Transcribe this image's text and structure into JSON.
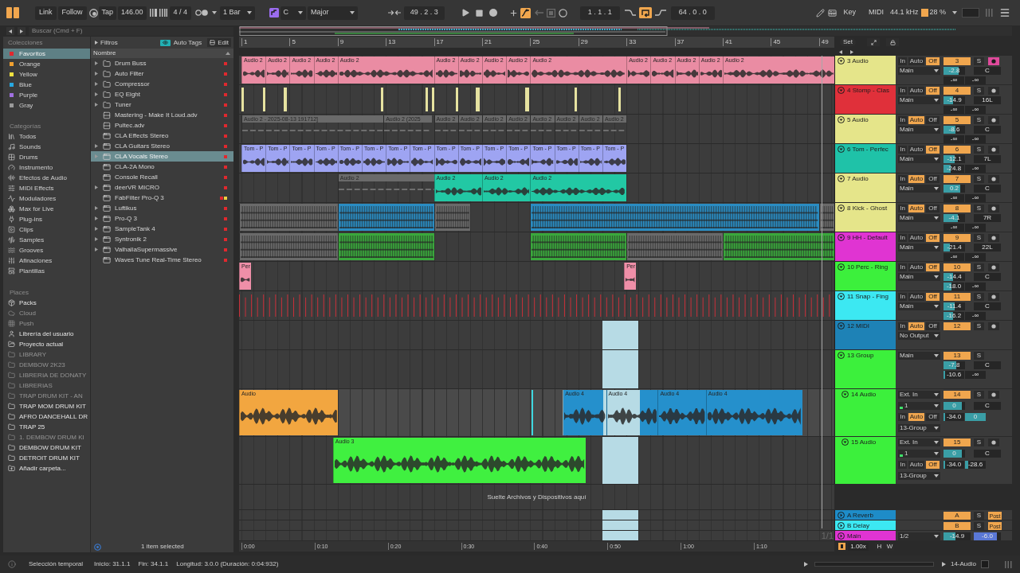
{
  "toolbar": {
    "link": "Link",
    "follow": "Follow",
    "tap": "Tap",
    "tempo": "146.00",
    "signature": "4 / 4",
    "quantization": "1 Bar",
    "key": {
      "on": true,
      "root": "C",
      "scale": "Major"
    },
    "position": "49 . 2 . 3",
    "automation_arm": true,
    "loop_start": "1 . 1 . 1",
    "loop": true,
    "loop_length": "64 . 0 . 0",
    "key_map": "Key",
    "midi_map": "MIDI",
    "sample_rate": "44.1 kHz",
    "cpu": "28 %"
  },
  "search": {
    "placeholder": "Buscar (Cmd + F)"
  },
  "browser": {
    "collections_title": "Colecciones",
    "filters": "Filtros",
    "auto_tags": {
      "label": "Auto Tags",
      "on": true
    },
    "edit": "Edit",
    "collections": [
      {
        "label": "Favoritos",
        "color": "#e0282e",
        "selected": true
      },
      {
        "label": "Orange",
        "color": "#f0a030",
        "selected": false
      },
      {
        "label": "Yellow",
        "color": "#f0e040",
        "selected": false
      },
      {
        "label": "Blue",
        "color": "#28a8e0",
        "selected": false
      },
      {
        "label": "Purple",
        "color": "#a070e0",
        "selected": false
      },
      {
        "label": "Gray",
        "color": "#9a9a9a",
        "selected": false
      }
    ],
    "categories_title": "Categorías",
    "categories": [
      {
        "label": "Todos",
        "kind": "all"
      },
      {
        "label": "Sounds",
        "kind": "sounds"
      },
      {
        "label": "Drums",
        "kind": "drums"
      },
      {
        "label": "Instrumento",
        "kind": "instruments"
      },
      {
        "label": "Efectos de Audio",
        "kind": "audio_effects"
      },
      {
        "label": "MIDI Effects",
        "kind": "midi_effects"
      },
      {
        "label": "Moduladores",
        "kind": "modulators"
      },
      {
        "label": "Max for Live",
        "kind": "max"
      },
      {
        "label": "Plug-ins",
        "kind": "plugins"
      },
      {
        "label": "Clips",
        "kind": "clips"
      },
      {
        "label": "Samples",
        "kind": "samples"
      },
      {
        "label": "Grooves",
        "kind": "grooves"
      },
      {
        "label": "Afinaciones",
        "kind": "tunings"
      },
      {
        "label": "Plantillas",
        "kind": "templates"
      }
    ],
    "places_title": "Places",
    "places": [
      {
        "label": "Packs",
        "kind": "packs",
        "disabled": false
      },
      {
        "label": "Cloud",
        "kind": "cloud",
        "disabled": true
      },
      {
        "label": "Push",
        "kind": "push",
        "disabled": true
      },
      {
        "label": "Librería del usuario",
        "kind": "user",
        "disabled": false
      },
      {
        "label": "Proyecto actual",
        "kind": "project",
        "disabled": false
      },
      {
        "label": "LIBRARY",
        "kind": "folder",
        "disabled": true
      },
      {
        "label": "DEMBOW 2K23",
        "kind": "folder",
        "disabled": true
      },
      {
        "label": "LIBRERIA DE DONATY",
        "kind": "folder",
        "disabled": true
      },
      {
        "label": "LIBRERIAS",
        "kind": "folder",
        "disabled": true
      },
      {
        "label": "TRAP DRUM KIT - AN",
        "kind": "folder",
        "disabled": true
      },
      {
        "label": "TRAP MOM DRUM KIT",
        "kind": "folder",
        "disabled": false
      },
      {
        "label": "AFRO DANCEHALL DR",
        "kind": "folder",
        "disabled": false
      },
      {
        "label": "TRAP 25",
        "kind": "folder",
        "disabled": false
      },
      {
        "label": "1. DEMBOW DRUM KI",
        "kind": "folder",
        "disabled": true
      },
      {
        "label": "DEMBOW DRUM KIT",
        "kind": "folder",
        "disabled": false
      },
      {
        "label": "DETROIT DRUM KIT",
        "kind": "folder",
        "disabled": false
      },
      {
        "label": "Añadir carpeta...",
        "kind": "add",
        "disabled": false
      }
    ],
    "column": "Nombre",
    "items": [
      {
        "label": "Drum Buss",
        "kind": "folder",
        "expandable": true,
        "selected": false,
        "tags": [
          {
            "color": "#e0282e"
          }
        ]
      },
      {
        "label": "Auto Filter",
        "kind": "folder",
        "expandable": true,
        "selected": false,
        "tags": [
          {
            "color": "#e0282e"
          }
        ]
      },
      {
        "label": "Compressor",
        "kind": "folder",
        "expandable": true,
        "selected": false,
        "tags": [
          {
            "color": "#e0282e"
          }
        ]
      },
      {
        "label": "EQ Eight",
        "kind": "folder",
        "expandable": true,
        "selected": false,
        "tags": [
          {
            "color": "#e0282e"
          }
        ]
      },
      {
        "label": "Tuner",
        "kind": "folder",
        "expandable": true,
        "selected": false,
        "tags": [
          {
            "color": "#e0282e"
          }
        ]
      },
      {
        "label": "Mastering - Make It Loud.adv",
        "kind": "preset",
        "expandable": false,
        "selected": false,
        "tags": [
          {
            "color": "#e0282e"
          }
        ]
      },
      {
        "label": "Pultec.adv",
        "kind": "preset",
        "expandable": false,
        "selected": false,
        "tags": [
          {
            "color": "#e0282e"
          }
        ]
      },
      {
        "label": "CLA Effects Stereo",
        "kind": "plugin",
        "expandable": false,
        "selected": false,
        "tags": [
          {
            "color": "#e0282e"
          }
        ]
      },
      {
        "label": "CLA Guitars Stereo",
        "kind": "plugin",
        "expandable": true,
        "selected": false,
        "tags": [
          {
            "color": "#e0282e"
          }
        ]
      },
      {
        "label": "CLA Vocals Stereo",
        "kind": "plugin",
        "expandable": true,
        "selected": true,
        "tags": [
          {
            "color": "#e0282e"
          }
        ]
      },
      {
        "label": "CLA-2A Mono",
        "kind": "plugin",
        "expandable": false,
        "selected": false,
        "tags": [
          {
            "color": "#e0282e"
          }
        ]
      },
      {
        "label": "Console Recall",
        "kind": "plugin",
        "expandable": false,
        "selected": false,
        "tags": [
          {
            "color": "#e0282e"
          }
        ]
      },
      {
        "label": "deerVR MICRO",
        "kind": "plugin",
        "expandable": true,
        "selected": false,
        "tags": [
          {
            "color": "#e0282e"
          }
        ]
      },
      {
        "label": "FabFilter Pro-Q 3",
        "kind": "plugin",
        "expandable": false,
        "selected": false,
        "tags": [
          {
            "color": "#e0282e"
          },
          {
            "color": "#f0d040"
          }
        ]
      },
      {
        "label": "Luftikus",
        "kind": "plugin",
        "expandable": true,
        "selected": false,
        "tags": [
          {
            "color": "#e0282e"
          }
        ]
      },
      {
        "label": "Pro-Q 3",
        "kind": "plugin",
        "expandable": true,
        "selected": false,
        "tags": [
          {
            "color": "#e0282e"
          }
        ]
      },
      {
        "label": "SampleTank 4",
        "kind": "plugin",
        "expandable": true,
        "selected": false,
        "tags": [
          {
            "color": "#e0282e"
          }
        ]
      },
      {
        "label": "Syntronik 2",
        "kind": "plugin",
        "expandable": true,
        "selected": false,
        "tags": [
          {
            "color": "#e0282e"
          }
        ]
      },
      {
        "label": "ValhallaSupermassive",
        "kind": "plugin",
        "expandable": true,
        "selected": false,
        "tags": [
          {
            "color": "#e0282e"
          }
        ]
      },
      {
        "label": "Waves Tune Real-Time Stereo",
        "kind": "plugin",
        "expandable": false,
        "selected": false,
        "tags": [
          {
            "color": "#e0282e"
          }
        ]
      }
    ],
    "footer": "1 item selected"
  },
  "arrangement": {
    "bars": [
      "1",
      "5",
      "9",
      "13",
      "17",
      "21",
      "25",
      "29",
      "33",
      "37",
      "41",
      "45",
      "49"
    ],
    "times": [
      "0:00",
      "0:10",
      "0:20",
      "0:30",
      "0:40",
      "0:50",
      "1:00",
      "1:10"
    ],
    "set": "Set",
    "drop_hint": "Suelte Archivos y Dispositivos aquí",
    "grid": "1/1"
  },
  "tracks": [
    {
      "name": "3 Audio",
      "color": "#e5e58a",
      "expanded": true,
      "selected": false,
      "in_time_selection": false,
      "clips": [
        {
          "kind": "audio",
          "label": "Audio 2",
          "color": "#ea8ca3"
        },
        {
          "kind": "audio",
          "label": "Audio 2",
          "color": "#ea8ca3"
        },
        {
          "kind": "audio",
          "label": "Audio 2",
          "color": "#ea8ca3"
        },
        {
          "kind": "audio",
          "label": "Audio 2",
          "color": "#ea8ca3"
        },
        {
          "kind": "audio",
          "label": "Audio 2",
          "color": "#ea8ca3"
        },
        {
          "kind": "audio",
          "label": "Audio 2",
          "color": "#ea8ca3"
        },
        {
          "kind": "audio",
          "label": "Audio 2",
          "color": "#ea8ca3"
        },
        {
          "kind": "audio",
          "label": "Audio 2",
          "color": "#ea8ca3"
        },
        {
          "kind": "audio",
          "label": "Audio 2",
          "color": "#ea8ca3"
        },
        {
          "kind": "audio",
          "label": "Audio 2",
          "color": "#ea8ca3"
        },
        {
          "kind": "audio",
          "label": "Audio 2",
          "color": "#ea8ca3"
        },
        {
          "kind": "audio",
          "label": "Audio 2",
          "color": "#ea8ca3"
        },
        {
          "kind": "audio",
          "label": "Audio 2",
          "color": "#ea8ca3"
        },
        {
          "kind": "audio",
          "label": "Audio 2",
          "color": "#ea8ca3"
        },
        {
          "kind": "audio",
          "label": "Audio 2",
          "color": "#ea8ca3"
        }
      ],
      "io": [
        {
          "kind": "monitor",
          "options": [
            {
              "label": "In",
              "selected": false
            },
            {
              "label": "Auto",
              "selected": false
            },
            {
              "label": "Off",
              "selected": true
            }
          ]
        },
        {
          "kind": "dropdown",
          "value": "Main"
        }
      ],
      "number": "3",
      "active": true,
      "solo": "S",
      "arm": true,
      "volume": {
        "value": "-2.8",
        "level": 0.72
      },
      "pan": "C",
      "sends": [
        {
          "value": "-∞"
        },
        {
          "value": "-∞"
        }
      ]
    },
    {
      "name": "4 Stomp - Clas",
      "color": "#e0303a",
      "expanded": true,
      "selected": false,
      "in_time_selection": false,
      "clips": [
        {
          "kind": "marker",
          "color": "#e6e2a0"
        },
        {
          "kind": "marker",
          "color": "#e6e2a0"
        },
        {
          "kind": "marker",
          "color": "#e6e2a0"
        },
        {
          "kind": "marker",
          "color": "#e6e2a0"
        },
        {
          "kind": "marker",
          "color": "#e6e2a0"
        },
        {
          "kind": "marker",
          "color": "#e6e2a0"
        },
        {
          "kind": "marker",
          "color": "#e6e2a0"
        },
        {
          "kind": "marker",
          "color": "#e6e2a0"
        },
        {
          "kind": "marker",
          "color": "#e6e2a0"
        },
        {
          "kind": "marker",
          "color": "#e6e2a0"
        },
        {
          "kind": "marker",
          "color": "#e6e2a0"
        }
      ],
      "io": [
        {
          "kind": "monitor",
          "options": [
            {
              "label": "In",
              "selected": false
            },
            {
              "label": "Auto",
              "selected": false
            },
            {
              "label": "Off",
              "selected": true
            }
          ]
        },
        {
          "kind": "dropdown",
          "value": "Main"
        }
      ],
      "number": "4",
      "active": true,
      "solo": "S",
      "arm": false,
      "volume": {
        "value": "-14.9",
        "level": 0.45
      },
      "pan": "16L",
      "sends": [
        {
          "value": "-∞"
        },
        {
          "value": "-∞"
        }
      ]
    },
    {
      "name": "5 Audio",
      "color": "#e5e58a",
      "expanded": true,
      "selected": false,
      "in_time_selection": false,
      "clips": [
        {
          "kind": "audio_off",
          "label": "Audio 2 - 2025-08-13 191712]",
          "color": "#6a6a6a"
        },
        {
          "kind": "audio_off",
          "label": "Audio 2 (2025",
          "color": "#6a6a6a"
        },
        {
          "kind": "audio_off",
          "label": "Audio 2",
          "color": "#6a6a6a"
        },
        {
          "kind": "audio_off",
          "label": "Audio 2",
          "color": "#6a6a6a"
        },
        {
          "kind": "audio_off",
          "label": "Audio 2",
          "color": "#6a6a6a"
        },
        {
          "kind": "audio_off",
          "label": "Audio 2",
          "color": "#6a6a6a"
        },
        {
          "kind": "audio_off",
          "label": "Audio 2",
          "color": "#6a6a6a"
        },
        {
          "kind": "audio_off",
          "label": "Audio 2",
          "color": "#6a6a6a"
        },
        {
          "kind": "audio_off",
          "label": "Audio 2",
          "color": "#6a6a6a"
        },
        {
          "kind": "audio_off",
          "label": "Audio 2",
          "color": "#6a6a6a"
        }
      ],
      "io": [
        {
          "kind": "monitor",
          "options": [
            {
              "label": "In",
              "selected": false
            },
            {
              "label": "Auto",
              "selected": true
            },
            {
              "label": "Off",
              "selected": false
            }
          ]
        },
        {
          "kind": "dropdown",
          "value": "Main"
        }
      ],
      "number": "5",
      "active": true,
      "solo": "S",
      "arm": false,
      "volume": {
        "value": "-8.6",
        "level": 0.55
      },
      "pan": "C",
      "sends": [
        {
          "value": "-∞"
        },
        {
          "value": "-∞"
        }
      ]
    },
    {
      "name": "6 Tom - Perfec",
      "color": "#1fc2a8",
      "expanded": true,
      "selected": false,
      "in_time_selection": false,
      "clips": [
        {
          "kind": "audio",
          "label": "Tom - P",
          "color": "#9ea4f2"
        },
        {
          "kind": "audio",
          "label": "Tom - P",
          "color": "#9ea4f2"
        },
        {
          "kind": "audio",
          "label": "Tom - P",
          "color": "#9ea4f2"
        },
        {
          "kind": "audio",
          "label": "Tom - P",
          "color": "#9ea4f2"
        },
        {
          "kind": "audio",
          "label": "Tom - P",
          "color": "#9ea4f2"
        },
        {
          "kind": "audio",
          "label": "Tom - P",
          "color": "#9ea4f2"
        },
        {
          "kind": "audio",
          "label": "Tom - P",
          "color": "#9ea4f2"
        },
        {
          "kind": "audio",
          "label": "Tom - P",
          "color": "#9ea4f2"
        },
        {
          "kind": "audio",
          "label": "Tom - P",
          "color": "#9ea4f2"
        },
        {
          "kind": "audio",
          "label": "Tom - P",
          "color": "#9ea4f2"
        },
        {
          "kind": "audio",
          "label": "Tom - P",
          "color": "#9ea4f2"
        },
        {
          "kind": "audio",
          "label": "Tom - P",
          "color": "#9ea4f2"
        },
        {
          "kind": "audio",
          "label": "Tom - P",
          "color": "#9ea4f2"
        },
        {
          "kind": "audio",
          "label": "Tom - P",
          "color": "#9ea4f2"
        },
        {
          "kind": "audio",
          "label": "Tom - P",
          "color": "#9ea4f2"
        },
        {
          "kind": "audio",
          "label": "Tom - P",
          "color": "#9ea4f2"
        }
      ],
      "io": [
        {
          "kind": "monitor",
          "options": [
            {
              "label": "In",
              "selected": false
            },
            {
              "label": "Auto",
              "selected": false
            },
            {
              "label": "Off",
              "selected": true
            }
          ]
        },
        {
          "kind": "dropdown",
          "value": "Main"
        }
      ],
      "number": "6",
      "active": true,
      "solo": "S",
      "arm": false,
      "volume": {
        "value": "-12.1",
        "level": 0.5
      },
      "pan": "7L",
      "sends": [
        {
          "value": "-24.8",
          "level": 0.35
        },
        {
          "value": "-∞"
        }
      ]
    },
    {
      "name": "7 Audio",
      "color": "#e5e58a",
      "expanded": true,
      "selected": false,
      "in_time_selection": false,
      "clips": [
        {
          "kind": "audio_off",
          "label": "Audio 2",
          "color": "#6a6a6a"
        },
        {
          "kind": "audio",
          "label": "Audio 2",
          "color": "#22c8a4"
        },
        {
          "kind": "audio",
          "label": "Audio 2",
          "color": "#22c8a4"
        },
        {
          "kind": "audio",
          "label": "Audio 2",
          "color": "#22c8a4"
        }
      ],
      "io": [
        {
          "kind": "monitor",
          "options": [
            {
              "label": "In",
              "selected": false
            },
            {
              "label": "Auto",
              "selected": true
            },
            {
              "label": "Off",
              "selected": false
            }
          ]
        },
        {
          "kind": "dropdown",
          "value": "Main"
        }
      ],
      "number": "7",
      "active": true,
      "solo": "S",
      "arm": false,
      "volume": {
        "value": "0.2",
        "level": 0.78
      },
      "pan": "C",
      "sends": [
        {
          "value": "-∞"
        },
        {
          "value": "-∞"
        }
      ]
    },
    {
      "name": "8 Kick - Ghost",
      "color": "#e5e58a",
      "expanded": true,
      "selected": false,
      "in_time_selection": false,
      "clips": [
        {
          "kind": "midi",
          "color": "#6a6a6a"
        },
        {
          "kind": "midi",
          "color": "#2a8cc2"
        },
        {
          "kind": "midi",
          "color": "#6a6a6a"
        },
        {
          "kind": "midi",
          "color": "#2a8cc2"
        },
        {
          "kind": "midi",
          "color": "#6a6a6a"
        }
      ],
      "io": [
        {
          "kind": "monitor",
          "options": [
            {
              "label": "In",
              "selected": false
            },
            {
              "label": "Auto",
              "selected": true
            },
            {
              "label": "Off",
              "selected": false
            }
          ]
        },
        {
          "kind": "dropdown",
          "value": "Main"
        }
      ],
      "number": "8",
      "active": true,
      "solo": "S",
      "arm": false,
      "volume": {
        "value": "-4.1",
        "level": 0.68
      },
      "pan": "7R",
      "sends": [
        {
          "value": "-∞"
        },
        {
          "value": "-∞"
        }
      ]
    },
    {
      "name": "9 HH - Default",
      "color": "#e034d2",
      "expanded": true,
      "selected": false,
      "in_time_selection": false,
      "clips": [
        {
          "kind": "midi",
          "color": "#6a6a6a"
        },
        {
          "kind": "midi",
          "color": "#3aa83c"
        },
        {
          "kind": "midi",
          "color": "#3aa83c"
        },
        {
          "kind": "midi",
          "color": "#6a6a6a"
        },
        {
          "kind": "midi",
          "color": "#3aa83c"
        }
      ],
      "io": [
        {
          "kind": "monitor",
          "options": [
            {
              "label": "In",
              "selected": false
            },
            {
              "label": "Auto",
              "selected": false
            },
            {
              "label": "Off",
              "selected": true
            }
          ]
        },
        {
          "kind": "dropdown",
          "value": "Main"
        }
      ],
      "number": "9",
      "active": true,
      "solo": "S",
      "arm": false,
      "volume": {
        "value": "-21.4",
        "level": 0.3
      },
      "pan": "22L",
      "sends": [
        {
          "value": "-∞"
        },
        {
          "value": "-∞"
        }
      ]
    },
    {
      "name": "10 Perc - Ring",
      "color": "#3cf03c",
      "expanded": true,
      "selected": false,
      "in_time_selection": false,
      "clips": [
        {
          "kind": "audio",
          "label": "Per",
          "color": "#ef8fa8"
        },
        {
          "kind": "audio",
          "label": "Per",
          "color": "#ef8fa8"
        }
      ],
      "io": [
        {
          "kind": "monitor",
          "options": [
            {
              "label": "In",
              "selected": false
            },
            {
              "label": "Auto",
              "selected": false
            },
            {
              "label": "Off",
              "selected": true
            }
          ]
        },
        {
          "kind": "dropdown",
          "value": "Main"
        }
      ],
      "number": "10",
      "active": true,
      "solo": "S",
      "arm": false,
      "volume": {
        "value": "-14.4",
        "level": 0.45
      },
      "pan": "C",
      "sends": [
        {
          "value": "-18.0",
          "level": 0.4
        },
        {
          "value": "-∞"
        }
      ]
    },
    {
      "name": "11 Snap - Fing",
      "color": "#3ce8f2",
      "expanded": true,
      "selected": false,
      "in_time_selection": false,
      "clips": [
        {
          "kind": "lines",
          "color": "#c8303a"
        }
      ],
      "io": [
        {
          "kind": "monitor",
          "options": [
            {
              "label": "In",
              "selected": false
            },
            {
              "label": "Auto",
              "selected": false
            },
            {
              "label": "Off",
              "selected": true
            }
          ]
        },
        {
          "kind": "dropdown",
          "value": "Main"
        }
      ],
      "number": "11",
      "active": true,
      "solo": "S",
      "arm": false,
      "volume": {
        "value": "-11.4",
        "level": 0.5
      },
      "pan": "C",
      "sends": [
        {
          "value": "-16.2",
          "level": 0.45
        },
        {
          "value": "-∞"
        }
      ]
    },
    {
      "name": "12 MIDI",
      "color": "#1e82b6",
      "expanded": true,
      "selected": false,
      "in_time_selection": true,
      "io": [
        {
          "kind": "monitor",
          "options": [
            {
              "label": "In",
              "selected": false
            },
            {
              "label": "Auto",
              "selected": true
            },
            {
              "label": "Off",
              "selected": false
            }
          ]
        },
        {
          "kind": "dropdown",
          "value": "No Output"
        }
      ],
      "number": "12",
      "active": true,
      "solo": "S",
      "arm": false
    },
    {
      "name": "13 Group",
      "color": "#3cf03c",
      "expanded": true,
      "selected": false,
      "in_time_selection": true,
      "io": [
        {
          "kind": "dropdown",
          "value": "Main"
        }
      ],
      "number": "13",
      "active": true,
      "solo": "S",
      "volume": {
        "value": "-7.8",
        "level": 0.6
      },
      "pan": "C",
      "sends": [
        {
          "value": "-10.6",
          "level": 0.08
        },
        {
          "value": "-∞"
        }
      ],
      "children": [
        {
          "name": "14 Audio",
          "color": "#3cf03c",
          "expanded": true,
          "selected": true,
          "in_time_selection": true,
          "insert_marker": true,
          "clips": [
            {
              "kind": "audio",
              "label": "Audio",
              "color": "#f2a640"
            },
            {
              "kind": "audio",
              "label": "Audio 4",
              "color": "#2590cc"
            },
            {
              "kind": "audio",
              "label": "Audio 4",
              "color": "#2590cc"
            },
            {
              "kind": "audio",
              "label": "Audio 4",
              "color": "#2590cc"
            },
            {
              "kind": "audio",
              "label": "Audio 4",
              "color": "#2590cc"
            }
          ],
          "io": [
            {
              "kind": "dropdown",
              "value": "Ext. In"
            },
            {
              "kind": "channel",
              "value": "1"
            },
            {
              "kind": "monitor",
              "options": [
                {
                  "label": "In",
                  "selected": false
                },
                {
                  "label": "Auto",
                  "selected": true
                },
                {
                  "label": "Off",
                  "selected": false
                }
              ]
            },
            {
              "kind": "dropdown",
              "value": "13-Group"
            }
          ],
          "number": "14",
          "active": true,
          "solo": "S",
          "arm": false,
          "volume": {
            "value": "0",
            "level": 0.85
          },
          "pan": "C",
          "sends": [
            {
              "value": "-34.0",
              "level": 0.08
            },
            {
              "value": "0",
              "level": 1
            }
          ]
        },
        {
          "name": "15 Audio",
          "color": "#3cf03c",
          "expanded": true,
          "selected": false,
          "in_time_selection": true,
          "clips": [
            {
              "kind": "audio",
              "label": "Audio 3",
              "color": "#40f040"
            }
          ],
          "io": [
            {
              "kind": "dropdown",
              "value": "Ext. In"
            },
            {
              "kind": "channel",
              "value": "1"
            },
            {
              "kind": "monitor",
              "options": [
                {
                  "label": "In",
                  "selected": false
                },
                {
                  "label": "Auto",
                  "selected": false
                },
                {
                  "label": "Off",
                  "selected": true
                }
              ]
            },
            {
              "kind": "dropdown",
              "value": "13-Group"
            }
          ],
          "number": "15",
          "active": true,
          "solo": "S",
          "arm": false,
          "volume": {
            "value": "0",
            "level": 0.85
          },
          "pan": "C",
          "sends": [
            {
              "value": "-34.0",
              "level": 0.08
            },
            {
              "value": "-28.6",
              "level": 0.15
            }
          ]
        }
      ]
    }
  ],
  "returns": [
    {
      "name": "A Reverb",
      "color": "#1e8cc8",
      "expanded": false,
      "selected": false,
      "in_time_selection": true,
      "number": "A",
      "active": true,
      "solo": "S",
      "post": {
        "label": "Post",
        "on": true
      }
    },
    {
      "name": "B Delay",
      "color": "#3ce8f2",
      "expanded": false,
      "selected": false,
      "in_time_selection": true,
      "number": "B",
      "active": true,
      "solo": "S",
      "post": {
        "label": "Post",
        "on": true
      }
    }
  ],
  "main": {
    "name": "Main",
    "color": "#e034d2",
    "expanded": false,
    "selected": false,
    "in_time_selection": true,
    "io": [
      {
        "kind": "dropdown",
        "value": "1/2"
      }
    ],
    "volume": {
      "value": "-14.9",
      "level": 0.45
    },
    "cue": {
      "value": "-6.0",
      "level": 0.85
    }
  },
  "mixer_footer": {
    "zoom": "1.00x",
    "h": "H",
    "w": "W"
  },
  "status_bar": {
    "mode": "Selección temporal",
    "start": "Inicio: 31.1.1",
    "end": "Fin: 34.1.1",
    "length": "Longitud: 3.0.0 (Duración: 0:04:932)",
    "track": "14-Audio"
  }
}
